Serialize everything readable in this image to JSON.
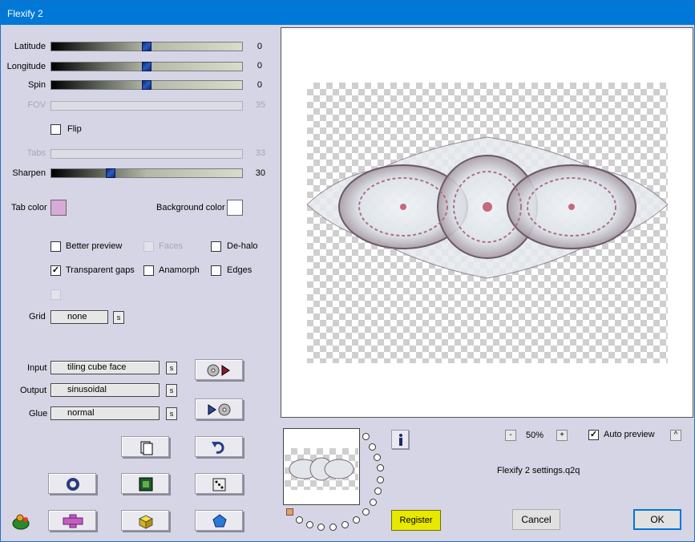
{
  "window": {
    "title": "Flexify 2"
  },
  "sliders": [
    {
      "label": "Latitude",
      "value": "0",
      "level": 0.5,
      "enabled": true
    },
    {
      "label": "Longitude",
      "value": "0",
      "level": 0.5,
      "enabled": true
    },
    {
      "label": "Spin",
      "value": "0",
      "level": 0.5,
      "enabled": true
    },
    {
      "label": "FOV",
      "value": "35",
      "enabled": false
    },
    {
      "label": "Tabs",
      "value": "33",
      "enabled": false
    },
    {
      "label": "Sharpen",
      "value": "30",
      "level": 0.3,
      "enabled": true
    }
  ],
  "flip": {
    "label": "Flip",
    "checked": false
  },
  "colors": {
    "tab_color_label": "Tab color",
    "tab_color": "#d8aad8",
    "background_color_label": "Background color",
    "background_color": "#ffffff"
  },
  "options": {
    "better_preview": {
      "label": "Better preview",
      "checked": false
    },
    "faces": {
      "label": "Faces",
      "checked": false,
      "enabled": false
    },
    "de_halo": {
      "label": "De-halo",
      "checked": false
    },
    "transparent_gaps": {
      "label": "Transparent gaps",
      "checked": true
    },
    "anamorph": {
      "label": "Anamorph",
      "checked": false
    },
    "edges": {
      "label": "Edges",
      "checked": false
    }
  },
  "grid": {
    "label": "Grid",
    "value": "none",
    "s_label": "s"
  },
  "mapping": {
    "input_label": "Input",
    "input_value": "tiling cube face",
    "output_label": "Output",
    "output_value": "sinusoidal",
    "glue_label": "Glue",
    "glue_value": "normal",
    "s_label": "s"
  },
  "icons": [
    "disk-load-icon",
    "disk-save-icon",
    "copy-page-icon",
    "undo-icon",
    "ring-icon",
    "square-frame-icon",
    "dice-icon",
    "flexify-logo-icon",
    "plus-cross-icon",
    "yellow-cube-icon",
    "blue-pentagon-icon",
    "info-icon"
  ],
  "preview": {
    "zoom": "50%",
    "zoom_out": "-",
    "zoom_in": "+",
    "auto_preview_label": "Auto preview",
    "auto_preview": true,
    "collapse_label": "^"
  },
  "settings_file": "Flexify 2 settings.q2q",
  "buttons": {
    "register": "Register",
    "cancel": "Cancel",
    "ok": "OK"
  }
}
